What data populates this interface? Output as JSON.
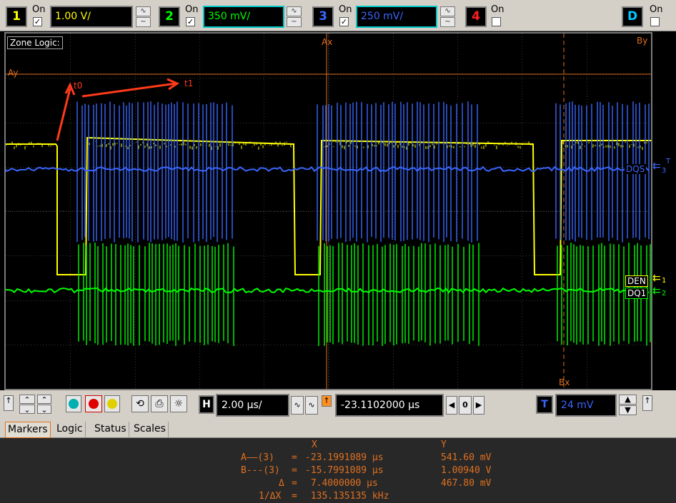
{
  "channels": [
    {
      "num": "1",
      "on": "On",
      "checked": "✓",
      "scale": "1.00 V/",
      "color": "#ffff00",
      "border": "#808080"
    },
    {
      "num": "2",
      "on": "On",
      "checked": "✓",
      "scale": "350 mV/",
      "color": "#00ff00",
      "border": "#00c8c8"
    },
    {
      "num": "3",
      "on": "On",
      "checked": "✓",
      "scale": "250 mV/",
      "color": "#3a66ff",
      "border": "#00c8c8"
    },
    {
      "num": "4",
      "on": "On",
      "checked": "",
      "color": "#ff2020"
    }
  ],
  "digital": {
    "label": "D",
    "on": "On",
    "checked": ""
  },
  "screen": {
    "zone_label": "Zone Logic:",
    "markers": {
      "ax": "Ax",
      "ay": "Ay",
      "bx": "Bx",
      "by": "By"
    },
    "annotations": {
      "t0": "t0",
      "t1": "t1"
    },
    "channel_labels": {
      "dqs": "DQS",
      "den": "DEN",
      "dq1": "DQ1",
      "gnd3": "3",
      "gnd1": "1",
      "gnd2": "2",
      "trig": "T"
    }
  },
  "controls": {
    "horiz_label": "H",
    "timebase": "2.00 µs/",
    "delay": "-23.1102000 µs",
    "delay_ref": "0",
    "trigger_label": "T",
    "trigger_level": "24 mV"
  },
  "tabs": [
    {
      "label": "Markers",
      "active": true
    },
    {
      "label": "Logic",
      "active": false
    },
    {
      "label": "Status",
      "active": false
    },
    {
      "label": "Scales",
      "active": false
    }
  ],
  "markers_panel": {
    "header_x": "X",
    "header_y": "Y",
    "rows": [
      {
        "name": "A——(3)",
        "eq": "=",
        "x": "-23.1991089 µs",
        "y": "541.60 mV"
      },
      {
        "name": "B---(3)",
        "eq": "=",
        "x": "-15.7991089 µs",
        "y": "1.00940 V"
      },
      {
        "name": "Δ",
        "eq": "=",
        "x": " 7.4000000 µs",
        "y": "467.80 mV"
      },
      {
        "name": "1/ΔX",
        "eq": "=",
        "x": " 135.135135 kHz",
        "y": ""
      }
    ]
  }
}
